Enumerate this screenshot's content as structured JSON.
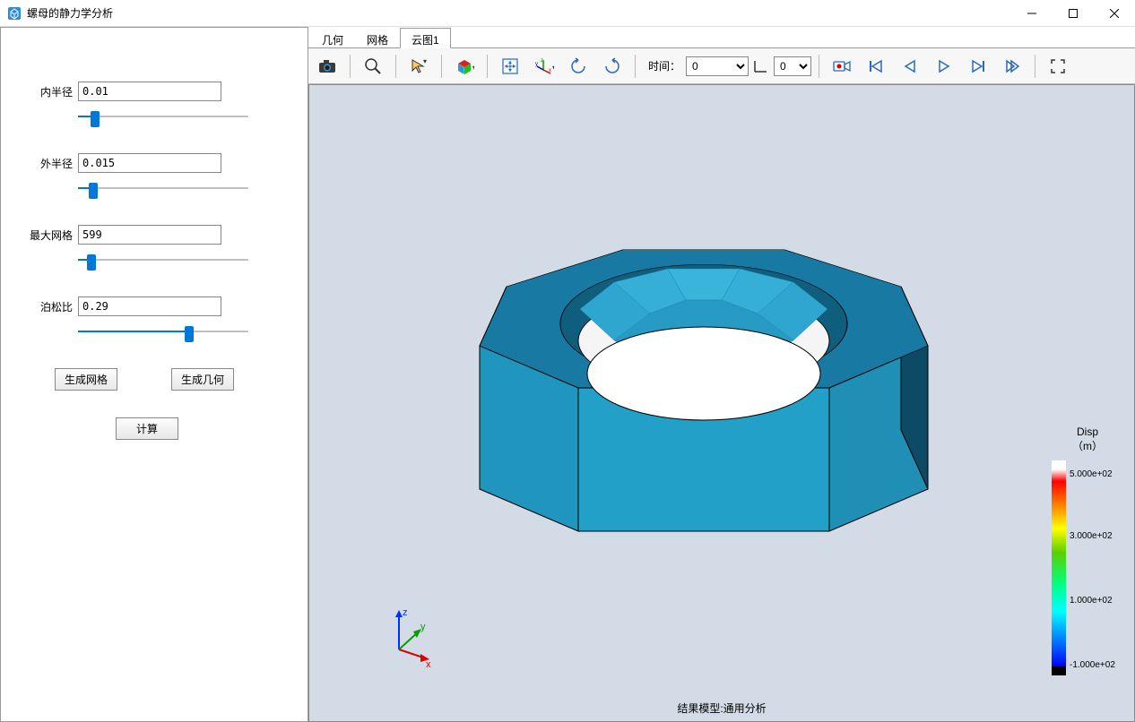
{
  "window": {
    "title": "螺母的静力学分析"
  },
  "sidebar": {
    "params": [
      {
        "label": "内半径",
        "value": "0.01",
        "slider_pct": 10
      },
      {
        "label": "外半径",
        "value": "0.015",
        "slider_pct": 9
      },
      {
        "label": "最大网格",
        "value": "599",
        "slider_pct": 8
      },
      {
        "label": "泊松比",
        "value": "0.29",
        "slider_pct": 65
      }
    ],
    "btn_gen_mesh": "生成网格",
    "btn_gen_geom": "生成几何",
    "btn_compute": "计算"
  },
  "tabs": [
    {
      "label": "几何",
      "active": false
    },
    {
      "label": "网格",
      "active": false
    },
    {
      "label": "云图1",
      "active": true
    }
  ],
  "toolbar": {
    "time_label": "时间：",
    "time_value": "0",
    "step_value": "0"
  },
  "viewport": {
    "status": "结果模型:通用分析",
    "legend_title1": "Disp",
    "legend_title2": "（m）",
    "legend_ticks": [
      {
        "text": "5.000e+02",
        "pos": 4
      },
      {
        "text": "3.000e+02",
        "pos": 33
      },
      {
        "text": "1.000e+02",
        "pos": 63
      },
      {
        "text": "-1.000e+02",
        "pos": 93
      }
    ]
  },
  "icons": {
    "camera": "camera-icon",
    "zoom": "zoom-icon",
    "select": "select-icon",
    "color": "color-icon",
    "fit": "fit-icon",
    "orient": "orient-icon",
    "rotate-left": "rotate-left-icon",
    "rotate-right": "rotate-right-icon",
    "record": "record-icon",
    "first": "first-icon",
    "prev": "prev-icon",
    "play": "play-icon",
    "next": "next-icon",
    "last": "last-icon",
    "expand": "expand-icon"
  }
}
